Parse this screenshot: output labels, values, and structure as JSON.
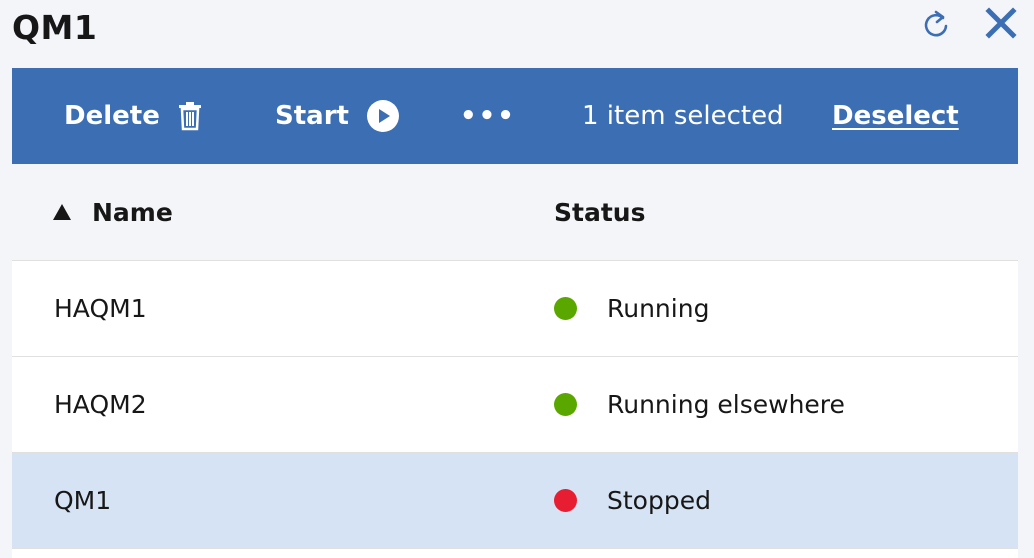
{
  "panel": {
    "title": "QM1"
  },
  "toolbar": {
    "delete_label": "Delete",
    "start_label": "Start",
    "more_label": "•••",
    "selection_text": "1 item selected",
    "deselect_label": "Deselect",
    "color": "#3c6eb4"
  },
  "table": {
    "columns": [
      {
        "label": "Name",
        "sort": "ascending"
      },
      {
        "label": "Status"
      }
    ],
    "rows": [
      {
        "name": "HAQM1",
        "status": "Running",
        "status_color": "#5aa700",
        "selected": false
      },
      {
        "name": "HAQM2",
        "status": "Running elsewhere",
        "status_color": "#5aa700",
        "selected": false
      },
      {
        "name": "QM1",
        "status": "Stopped",
        "status_color": "#e71d32",
        "selected": true
      }
    ]
  },
  "icons": {
    "refresh": "refresh-icon",
    "close": "close-icon",
    "delete": "trash-icon",
    "start": "play-icon",
    "sort": "sort-ascending-icon"
  }
}
